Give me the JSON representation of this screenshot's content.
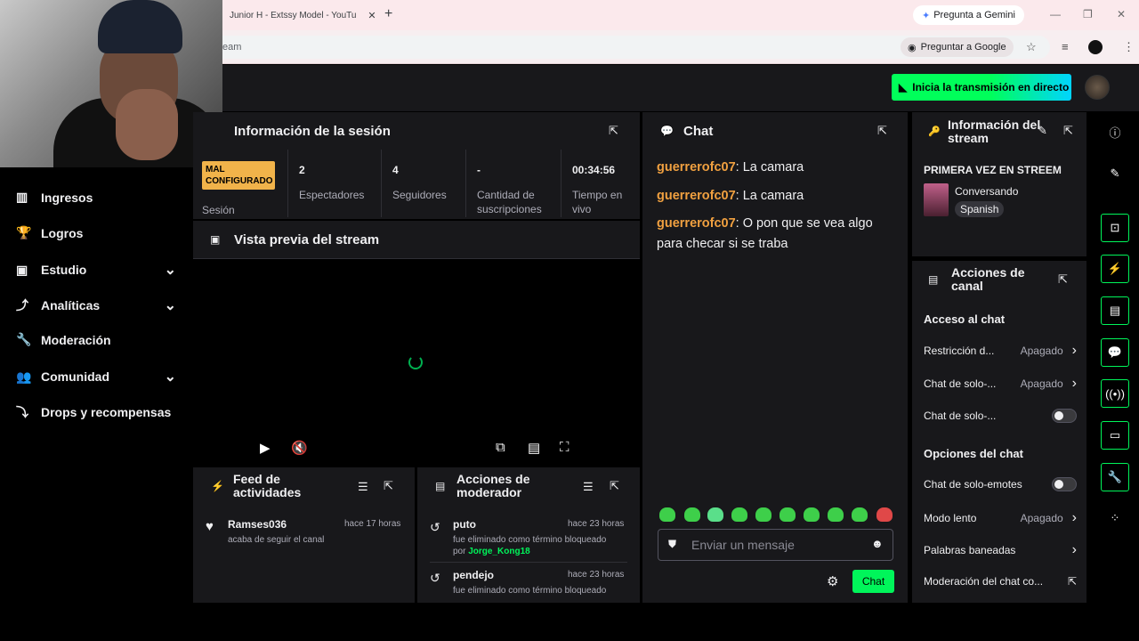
{
  "browser": {
    "tab_title": "Junior H - Extssy Model - YouTu",
    "tab_close": "✕",
    "new_tab": "+",
    "gemini_label": "Pregunta a Gemini",
    "url": "eam",
    "ask_google": "Preguntar a Google",
    "window_controls": [
      "—",
      "❐",
      "✕"
    ]
  },
  "header": {
    "go_live_label": "Inicia la transmisión en directo"
  },
  "sidebar": {
    "items": [
      {
        "label": "Ingresos",
        "icon": "bar-chart-icon",
        "glyph": "▥",
        "chevron": false
      },
      {
        "label": "Logros",
        "icon": "trophy-icon",
        "glyph": "🏆",
        "chevron": false
      },
      {
        "label": "Estudio",
        "icon": "studio-icon",
        "glyph": "▣",
        "chevron": true
      },
      {
        "label": "Analíticas",
        "icon": "analytics-icon",
        "glyph": "⤴",
        "chevron": true
      },
      {
        "label": "Moderación",
        "icon": "wrench-icon",
        "glyph": "🔧",
        "chevron": false
      },
      {
        "label": "Comunidad",
        "icon": "community-icon",
        "glyph": "👥",
        "chevron": true
      },
      {
        "label": "Drops y recompensas",
        "icon": "drops-icon",
        "glyph": "⤵",
        "chevron": false
      }
    ]
  },
  "session": {
    "title": "Información de la sesión",
    "badge": "MAL CONFIGURADO",
    "badge_label": "Sesión",
    "stats": [
      {
        "value": "2",
        "label": "Espectadores"
      },
      {
        "value": "4",
        "label": "Seguidores"
      },
      {
        "value": "-",
        "label": "Cantidad de suscripciones"
      },
      {
        "value": "00:34:56",
        "label": "Tiempo en vivo"
      }
    ]
  },
  "preview": {
    "title": "Vista previa del stream"
  },
  "feed": {
    "title": "Feed de actividades",
    "events": [
      {
        "user": "Ramses036",
        "time": "hace 17 horas",
        "desc": "acaba de seguir el canal"
      }
    ]
  },
  "mod_actions": {
    "title": "Acciones de moderador",
    "events": [
      {
        "user": "puto",
        "time": "hace 23 horas",
        "desc": "fue eliminado como término bloqueado",
        "by_prefix": "por",
        "by": "Jorge_Kong18"
      },
      {
        "user": "pendejo",
        "time": "hace 23 horas",
        "desc": "fue eliminado como término bloqueado"
      }
    ]
  },
  "chat": {
    "title": "Chat",
    "messages": [
      {
        "user": "guerrerofc07",
        "text": ": La camara"
      },
      {
        "user": "guerrerofc07",
        "text": ": La camara"
      },
      {
        "user": "guerrerofc07",
        "text": ": O pon que se vea algo para checar si se traba"
      }
    ],
    "placeholder": "Enviar un mensaje",
    "send_label": "Chat"
  },
  "stream_info": {
    "title": "Información del stream",
    "stream_title": "PRIMERA VEZ EN STREEM",
    "category": "Conversando",
    "language": "Spanish"
  },
  "channel_actions": {
    "title": "Acciones de canal",
    "section1": "Acceso al chat",
    "section2": "Opciones del chat",
    "rows": [
      {
        "name": "Restricción d...",
        "value": "Apagado",
        "type": "arrow"
      },
      {
        "name": "Chat de solo-...",
        "value": "Apagado",
        "type": "arrow"
      },
      {
        "name": "Chat de solo-...",
        "value": "",
        "type": "toggle"
      },
      {
        "name": "Chat de solo-emotes",
        "value": "",
        "type": "toggle"
      },
      {
        "name": "Modo lento",
        "value": "Apagado",
        "type": "arrow"
      },
      {
        "name": "Palabras baneadas",
        "value": "",
        "type": "arrow"
      },
      {
        "name": "Moderación del chat co...",
        "value": "",
        "type": "external"
      }
    ]
  },
  "colors": {
    "accent_green": "#00f55a",
    "username_orange": "#f0a040",
    "panel_bg": "#18181b"
  }
}
